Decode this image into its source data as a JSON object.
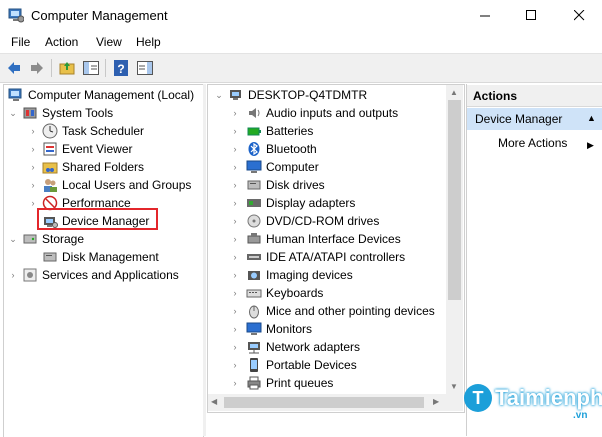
{
  "window": {
    "title": "Computer Management"
  },
  "menu": {
    "file": "File",
    "action": "Action",
    "view": "View",
    "help": "Help"
  },
  "tree": {
    "root": "Computer Management (Local)",
    "system_tools": "System Tools",
    "task_scheduler": "Task Scheduler",
    "event_viewer": "Event Viewer",
    "shared_folders": "Shared Folders",
    "local_users": "Local Users and Groups",
    "performance": "Performance",
    "device_manager": "Device Manager",
    "storage": "Storage",
    "disk_management": "Disk Management",
    "services": "Services and Applications"
  },
  "devices": {
    "computer_name": "DESKTOP-Q4TDMTR",
    "items": [
      "Audio inputs and outputs",
      "Batteries",
      "Bluetooth",
      "Computer",
      "Disk drives",
      "Display adapters",
      "DVD/CD-ROM drives",
      "Human Interface Devices",
      "IDE ATA/ATAPI controllers",
      "Imaging devices",
      "Keyboards",
      "Mice and other pointing devices",
      "Monitors",
      "Network adapters",
      "Portable Devices",
      "Print queues"
    ]
  },
  "actions": {
    "header": "Actions",
    "device_manager": "Device Manager",
    "more": "More Actions"
  },
  "watermark": {
    "brand": "Taimienphi",
    "logo_letter": "T",
    "tld": ".vn"
  },
  "colors": {
    "selection": "#cfe3f8",
    "highlight_box": "#e3262b",
    "brand": "#1c9fd9"
  }
}
